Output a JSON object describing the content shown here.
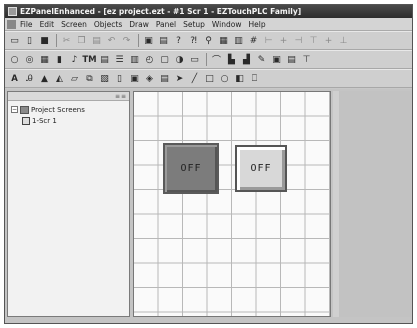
{
  "window": {
    "title": "EZPanelEnhanced - [ez project.ezt - #1 Scr 1 - EZTouchPLC Family]"
  },
  "menu": {
    "items": [
      "File",
      "Edit",
      "Screen",
      "Objects",
      "Draw",
      "Panel",
      "Setup",
      "Window",
      "Help"
    ]
  },
  "toolbar1": {
    "icons": [
      "new-icon",
      "open-icon",
      "save-icon",
      "cut-icon",
      "copy-icon",
      "paste-icon",
      "undo-icon",
      "redo-icon",
      "screen-icon",
      "print-icon",
      "help-icon",
      "context-help-icon",
      "zoom-icon",
      "grid-icon",
      "snap-icon",
      "grid-toggle-icon",
      "align-left-icon",
      "align-center-icon",
      "align-right-icon",
      "align-top-icon",
      "align-middle-icon",
      "align-bottom-icon"
    ]
  },
  "toolbar2": {
    "icons": [
      "indicator-light-icon",
      "multistate-light-icon",
      "bar-graph-icon",
      "pilot-light-icon",
      "tm-icon",
      "numeric-display-icon",
      "list-icon",
      "thumbwheel-icon",
      "clock-icon",
      "recipe-icon",
      "meter-icon",
      "trend-icon",
      "chart-icon",
      "alarm-icon",
      "bitmap-icon",
      "message-icon",
      "tm-label-icon",
      "dynamic-text-icon"
    ],
    "tm_label": "TM"
  },
  "toolbar3": {
    "text_label": "A",
    "icons": [
      "static-text-icon",
      "text-style-icon",
      "triangle-icon",
      "shape-icon",
      "frame-icon",
      "group-icon",
      "bitmap-button-icon",
      "page-icon",
      "pushbutton-icon",
      "selector-icon",
      "pointer-icon",
      "line-icon",
      "rectangle-icon",
      "ellipse-icon",
      "fill-icon",
      "rounded-rect-icon"
    ]
  },
  "tree": {
    "root_label": "Project Screens",
    "items": [
      {
        "label": "1-Scr 1"
      }
    ]
  },
  "canvas": {
    "buttons": [
      {
        "label": "OFF",
        "style": "dark"
      },
      {
        "label": "OFF",
        "style": "light"
      }
    ]
  }
}
